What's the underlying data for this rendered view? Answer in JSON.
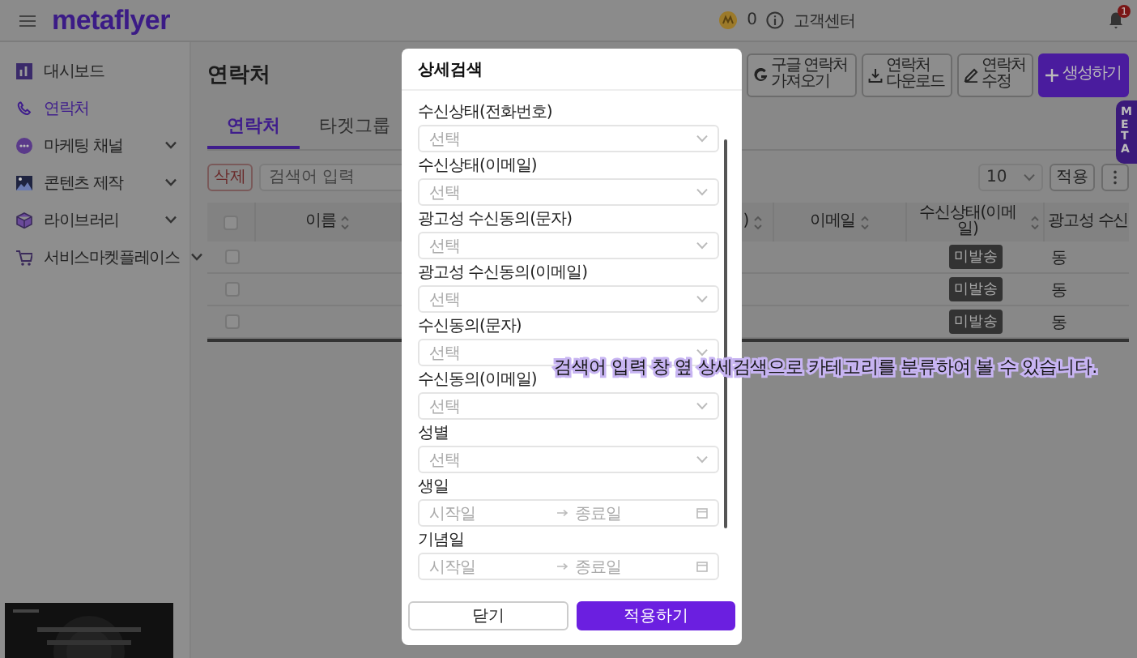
{
  "header": {
    "logo": "metaflyer",
    "points": "0",
    "help": "고객센터",
    "notification_count": "1"
  },
  "sidebar": {
    "items": [
      {
        "label": "대시보드",
        "selected": false,
        "has_submenu": false
      },
      {
        "label": "연락처",
        "selected": true,
        "has_submenu": false
      },
      {
        "label": "마케팅 채널",
        "selected": false,
        "has_submenu": true
      },
      {
        "label": "콘텐츠 제작",
        "selected": false,
        "has_submenu": true
      },
      {
        "label": "라이브러리",
        "selected": false,
        "has_submenu": true
      },
      {
        "label": "서비스마켓플레이스",
        "selected": false,
        "has_submenu": true
      }
    ]
  },
  "page": {
    "title": "연락처",
    "actions": [
      {
        "label": "구글 연락처 가져오기",
        "kind": "google"
      },
      {
        "label": "연락처 다운로드",
        "kind": "download"
      },
      {
        "label": "연락처 수정",
        "kind": "edit"
      },
      {
        "label": "생성하기",
        "kind": "create"
      }
    ]
  },
  "tabs": [
    {
      "label": "연락처",
      "selected": true
    },
    {
      "label": "타겟그룹",
      "selected": false
    }
  ],
  "toolbar": {
    "delete": "삭제",
    "search": {
      "placeholder": "검색어 입력"
    },
    "page_size": "10",
    "apply": "적용"
  },
  "table": {
    "columns": [
      "이름",
      ")",
      "이메일",
      "수신상태(이메일)",
      "광고성 수신"
    ],
    "all_checked": false,
    "rows": [
      {
        "checked": false,
        "email_status": "미발송",
        "column_5": "동"
      },
      {
        "checked": false,
        "email_status": "미발송",
        "column_5": "동"
      },
      {
        "checked": false,
        "email_status": "미발송",
        "column_5": "동"
      }
    ]
  },
  "side_tab": {
    "label": "META"
  },
  "modal": {
    "title": "상세검색",
    "fields": [
      {
        "label": "수신상태(전화번호)",
        "kind": "select",
        "placeholder": "선택"
      },
      {
        "label": "수신상태(이메일)",
        "kind": "select",
        "placeholder": "선택"
      },
      {
        "label": "광고성 수신동의(문자)",
        "kind": "select",
        "placeholder": "선택"
      },
      {
        "label": "광고성 수신동의(이메일)",
        "kind": "select",
        "placeholder": "선택"
      },
      {
        "label": "수신동의(문자)",
        "kind": "select",
        "placeholder": "선택"
      },
      {
        "label": "수신동의(이메일)",
        "kind": "select",
        "placeholder": "선택"
      },
      {
        "label": "성별",
        "kind": "select",
        "placeholder": "선택"
      },
      {
        "label": "생일",
        "kind": "date_range",
        "start_placeholder": "시작일",
        "end_placeholder": "종료일"
      },
      {
        "label": "기념일",
        "kind": "date_range",
        "start_placeholder": "시작일",
        "end_placeholder": "종료일"
      }
    ],
    "buttons": [
      {
        "label": "닫기",
        "kind": "secondary"
      },
      {
        "label": "적용하기",
        "kind": "primary"
      }
    ]
  },
  "caption": "검색어 입력 창 옆 상세검색으로 카테고리를 분류하여 볼 수 있습니다."
}
